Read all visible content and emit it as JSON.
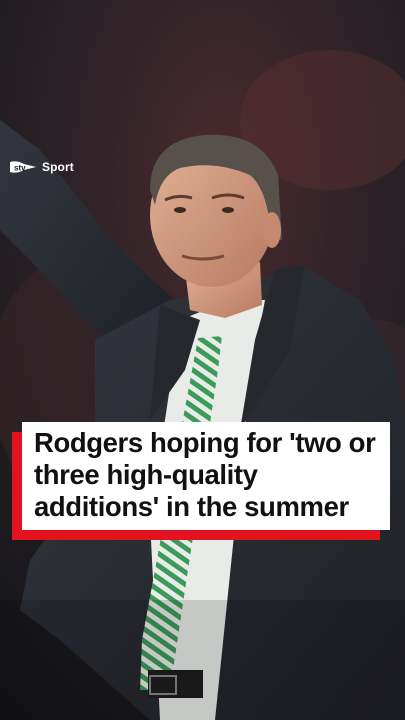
{
  "brand": {
    "logo_icon": "stv-logo-icon",
    "label": "Sport"
  },
  "headline": {
    "text": "Rodgers hoping for 'two or three high-quality additions' in the summer"
  },
  "colors": {
    "accent": "#e2121e",
    "suit": "#2b2e35",
    "background": "#1a1c22",
    "tie_green": "#3c9a5a"
  }
}
